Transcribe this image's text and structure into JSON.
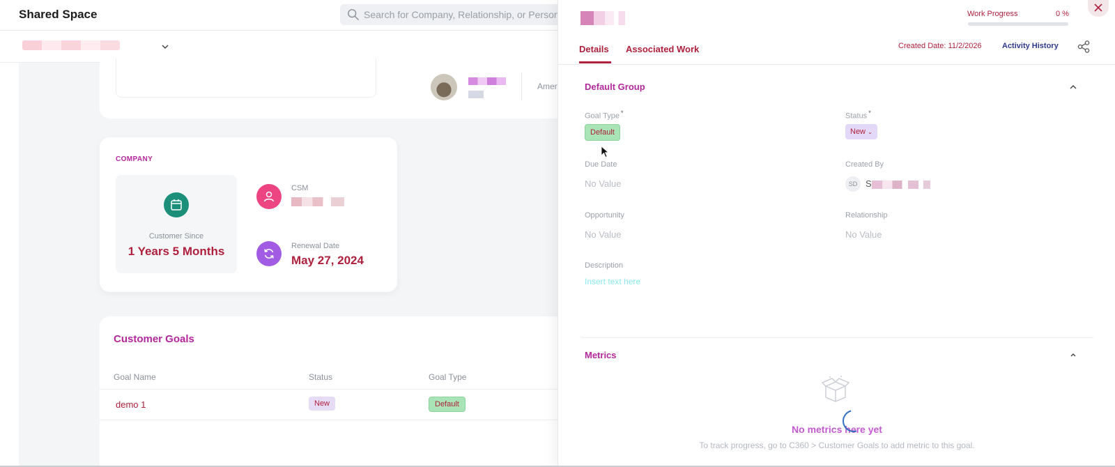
{
  "app": {
    "title": "Shared Space",
    "search_placeholder": "Search for Company, Relationship, or Person"
  },
  "company_card": {
    "section_label": "COMPANY",
    "customer_since_label": "Customer Since",
    "customer_since_value": "1 Years 5 Months",
    "csm_label": "CSM",
    "renewal_label": "Renewal Date",
    "renewal_value": "May 27, 2024"
  },
  "header_card": {
    "region_text": "Amer"
  },
  "customer_goals": {
    "title": "Customer Goals",
    "columns": [
      "Goal Name",
      "Status",
      "Goal Type"
    ],
    "rows": [
      {
        "name": "demo 1",
        "status": "New",
        "type": "Default"
      }
    ]
  },
  "drawer": {
    "work_progress_label": "Work Progress",
    "work_progress_value": "0 %",
    "work_progress_fraction": 0,
    "tabs": [
      {
        "label": "Details",
        "active": true
      },
      {
        "label": "Associated Work",
        "active": false
      }
    ],
    "created_date": "Created Date: 11/2/2026",
    "activity_history": "Activity History",
    "default_group": {
      "title": "Default Group",
      "goal_type_label": "Goal Type",
      "goal_type_value": "Default",
      "status_label": "Status",
      "status_value": "New",
      "due_date_label": "Due Date",
      "due_date_value": "No Value",
      "created_by_label": "Created By",
      "created_by_initials": "SD",
      "created_by_first": "S",
      "opportunity_label": "Opportunity",
      "opportunity_value": "No Value",
      "relationship_label": "Relationship",
      "relationship_value": "No Value",
      "description_label": "Description",
      "description_placeholder": "Insert text here"
    },
    "metrics": {
      "title": "Metrics",
      "empty_title": "No metrics here yet",
      "empty_subtitle": "To track progress, go to C360 > Customer Goals to add metric to this goal."
    }
  },
  "colors": {
    "accent": "#b0203c",
    "section_title": "#b3279c",
    "link_blue": "#2d3a8c",
    "goal_type_pill": "#a9e4b7",
    "status_pill": "#e3d8f8"
  }
}
